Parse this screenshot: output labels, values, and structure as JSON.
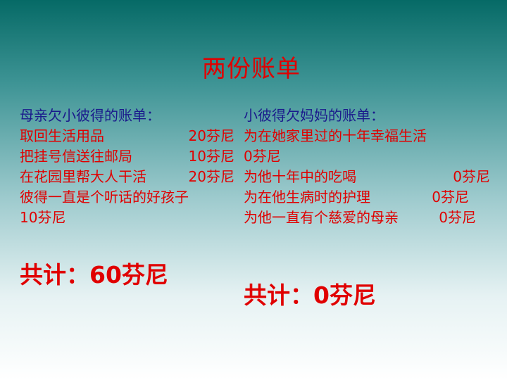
{
  "slide": {
    "title": "两份账单",
    "left": {
      "heading": "母亲欠小彼得的账单：",
      "items": [
        {
          "label": "取回生活用品",
          "amount": "20芬尼"
        },
        {
          "label": "把挂号信送往邮局",
          "amount": "10芬尼"
        },
        {
          "label": "在花园里帮大人干活",
          "amount": "20芬尼"
        }
      ],
      "wrap_item_label": "彼得一直是个听话的好孩子",
      "wrap_item_amount": "10芬尼",
      "total": "共计：60芬尼"
    },
    "right": {
      "heading": "小彼得欠妈妈的账单：",
      "item1_label": "为在她家里过的十年幸福生活",
      "item1_amount": "0芬尼",
      "items": [
        {
          "label": "为他十年中的吃喝",
          "amount": "0芬尼"
        },
        {
          "label": "为在他生病时的护理",
          "amount": "0芬尼"
        }
      ],
      "wrap_item_label": "为他一直有个慈爱的母亲",
      "wrap_item_amount": "0芬尼",
      "total": "共计：0芬尼"
    }
  }
}
